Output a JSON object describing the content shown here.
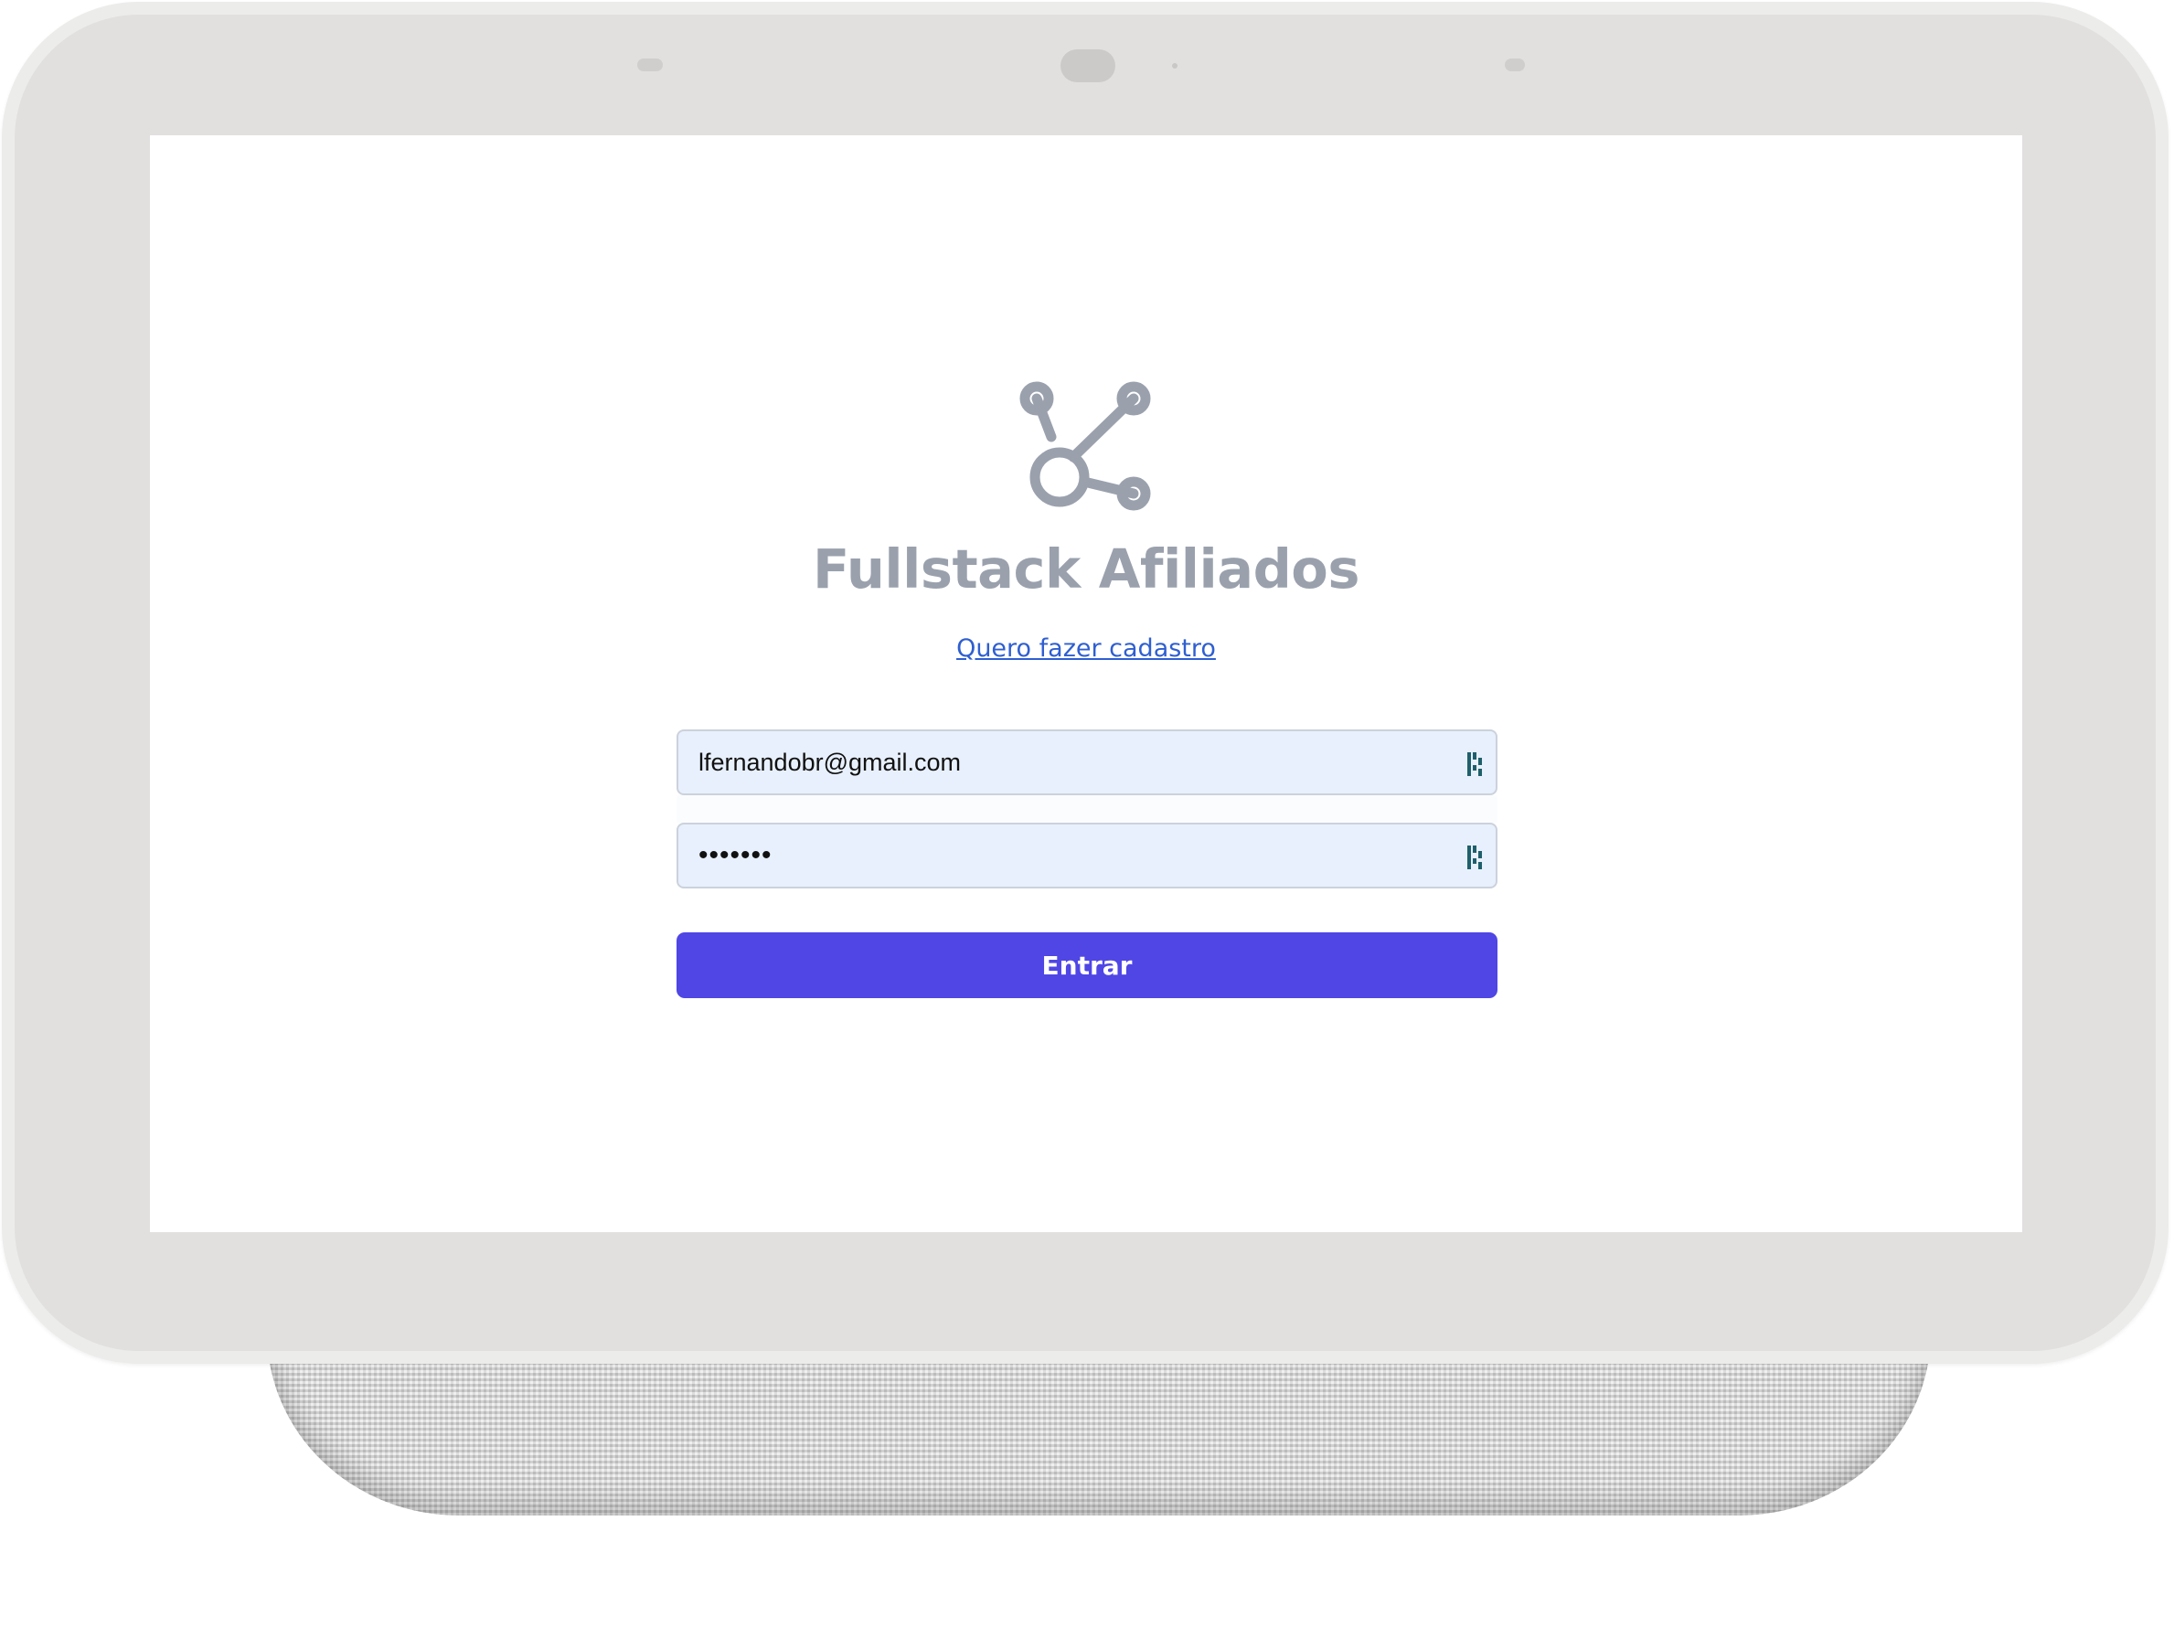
{
  "app": {
    "name": "Fullstack Afiliados",
    "logo_icon": "share-nodes-icon"
  },
  "login": {
    "signup_link": "Quero fazer cadastro",
    "email_value": "lfernandobr@gmail.com",
    "password_value": "•••••••",
    "submit_label": "Entrar"
  },
  "colors": {
    "brand_text": "#9aa1ad",
    "link": "#2f5fd0",
    "input_bg": "#e8f0fd",
    "button_bg": "#4f46e5",
    "button_text": "#ffffff",
    "field_icon": "#1f5f6b"
  },
  "icons": {
    "field_icon": "password-manager-icon"
  }
}
